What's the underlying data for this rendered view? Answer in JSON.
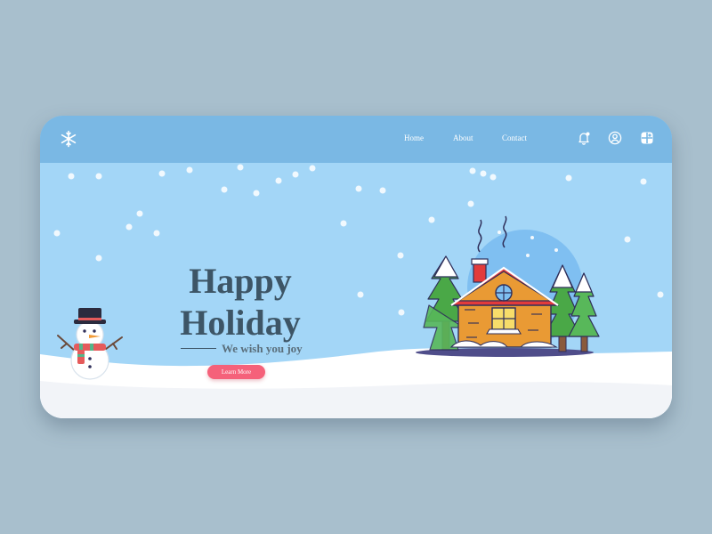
{
  "nav": {
    "home": "Home",
    "about": "About",
    "contact": "Contact"
  },
  "hero": {
    "title_line1": "Happy",
    "title_line2": "Holiday",
    "subtitle": "We wish you joy",
    "button": "Learn More"
  },
  "icons": {
    "logo": "snowflake-icon",
    "notification": "bell-icon",
    "account": "user-icon",
    "apps": "app-grid-icon"
  },
  "colors": {
    "page_background": "#a8bfcd",
    "header": "#7ab8e4",
    "sky": "#a3d6f7",
    "snow": "#f4f7fb",
    "title_text": "#3d5566",
    "button": "#f5617a"
  }
}
